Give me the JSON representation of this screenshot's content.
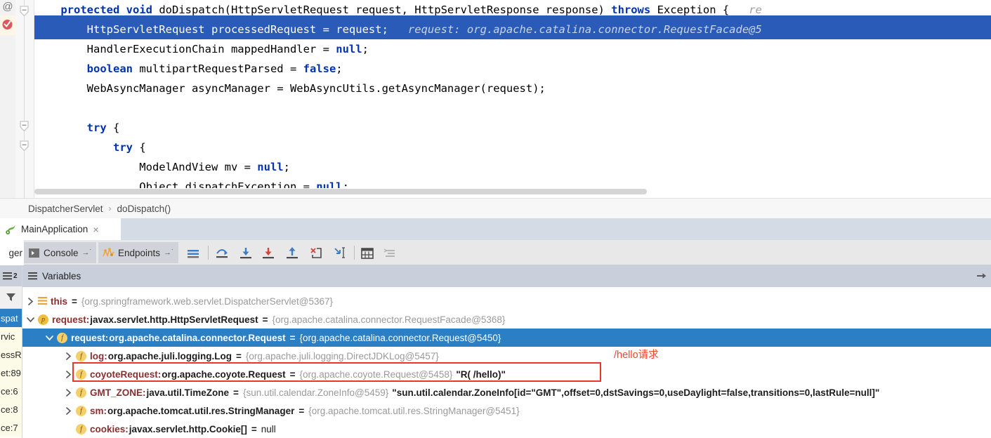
{
  "editor": {
    "gutter": {
      "annotation_icon": "@",
      "breakpoint_icon": "breakpoint-verified-icon",
      "fold_icons": [
        "fold-collapse-icon",
        "fold-collapse-icon"
      ]
    },
    "lines": [
      {
        "id": "l1",
        "highlighted": false,
        "segments": [
          {
            "text": "    ",
            "style": "plain"
          },
          {
            "text": "protected",
            "style": "kw"
          },
          {
            "text": " ",
            "style": "plain"
          },
          {
            "text": "void",
            "style": "kw"
          },
          {
            "text": " doDispatch(HttpServletRequest request, HttpServletResponse response) ",
            "style": "plain"
          },
          {
            "text": "throws",
            "style": "kw"
          },
          {
            "text": " Exception {",
            "style": "plain"
          },
          {
            "text": "   re",
            "style": "hint"
          }
        ]
      },
      {
        "id": "l2",
        "highlighted": true,
        "segments": [
          {
            "text": "        HttpServletRequest processedRequest = request;",
            "style": "plain"
          },
          {
            "text": "   request: org.apache.catalina.connector.RequestFacade@5",
            "style": "hint"
          }
        ]
      },
      {
        "id": "l3",
        "highlighted": false,
        "segments": [
          {
            "text": "        HandlerExecutionChain mappedHandler = ",
            "style": "plain"
          },
          {
            "text": "null",
            "style": "kw"
          },
          {
            "text": ";",
            "style": "plain"
          }
        ]
      },
      {
        "id": "l4",
        "highlighted": false,
        "segments": [
          {
            "text": "        ",
            "style": "plain"
          },
          {
            "text": "boolean",
            "style": "kw"
          },
          {
            "text": " multipartRequestParsed = ",
            "style": "plain"
          },
          {
            "text": "false",
            "style": "kw"
          },
          {
            "text": ";",
            "style": "plain"
          }
        ]
      },
      {
        "id": "l5",
        "highlighted": false,
        "segments": [
          {
            "text": "        WebAsyncManager asyncManager = WebAsyncUtils.getAsyncManager(request);",
            "style": "plain"
          }
        ]
      },
      {
        "id": "l6",
        "highlighted": false,
        "segments": []
      },
      {
        "id": "l7",
        "highlighted": false,
        "segments": [
          {
            "text": "        ",
            "style": "plain"
          },
          {
            "text": "try",
            "style": "kw"
          },
          {
            "text": " {",
            "style": "plain"
          }
        ]
      },
      {
        "id": "l8",
        "highlighted": false,
        "segments": [
          {
            "text": "            ",
            "style": "plain"
          },
          {
            "text": "try",
            "style": "kw"
          },
          {
            "text": " {",
            "style": "plain"
          }
        ]
      },
      {
        "id": "l9",
        "highlighted": false,
        "segments": [
          {
            "text": "                ModelAndView mv = ",
            "style": "plain"
          },
          {
            "text": "null",
            "style": "kw"
          },
          {
            "text": ";",
            "style": "plain"
          }
        ]
      },
      {
        "id": "l10",
        "highlighted": false,
        "segments": [
          {
            "text": "                Object dispatchException = ",
            "style": "plain"
          },
          {
            "text": "null",
            "style": "kw"
          },
          {
            "text": ";",
            "style": "plain"
          }
        ]
      }
    ]
  },
  "breadcrumb": {
    "class_name": "DispatcherServlet",
    "separator": "›",
    "method_name": "doDispatch()"
  },
  "run_tab": {
    "icon": "spring-leaf-icon",
    "label": "MainApplication",
    "close_label": "×"
  },
  "debug_toolbar": {
    "left_vtab_label": "ger",
    "console": {
      "label": "Console",
      "icon": "console-icon",
      "arrow": "→˙"
    },
    "endpoints": {
      "label": "Endpoints",
      "icon": "endpoints-icon",
      "arrow": "→˙"
    },
    "icon_buttons": [
      "show-execution-point-icon",
      "step-over-icon",
      "step-into-icon",
      "force-step-into-icon",
      "step-out-icon",
      "drop-frame-icon",
      "run-to-cursor-icon",
      "evaluate-expression-icon",
      "settings-lines-icon"
    ]
  },
  "frames_panel": {
    "header_icon": "frames-icon",
    "header_badge": "2",
    "filter_icon": "filter-icon",
    "rows": [
      {
        "text": "spat",
        "selected": true
      },
      {
        "text": "rvic",
        "selected": false
      },
      {
        "text": "essR",
        "selected": false
      },
      {
        "text": "et:89",
        "selected": false
      },
      {
        "text": "ce:6",
        "selected": false
      },
      {
        "text": "ce:8",
        "selected": false
      },
      {
        "text": "ce:7",
        "selected": false
      }
    ]
  },
  "variables_panel": {
    "title": "Variables",
    "header_icon": "hamburger-icon",
    "header_right_icon": "hide-panel-icon",
    "rows": [
      {
        "id": "r1",
        "indent": 0,
        "twisty": "collapsed",
        "badge_kind": "lines",
        "badge_text": "",
        "name": "this",
        "type": "",
        "eq": "=",
        "value": "{org.springframework.web.servlet.DispatcherServlet@5367}",
        "string_value": "",
        "selected": false
      },
      {
        "id": "r2",
        "indent": 0,
        "twisty": "expanded",
        "badge_kind": "p",
        "badge_text": "p",
        "name": "request:",
        "type": "javax.servlet.http.HttpServletRequest",
        "eq": "=",
        "value": "{org.apache.catalina.connector.RequestFacade@5368}",
        "string_value": "",
        "selected": false
      },
      {
        "id": "r3",
        "indent": 1,
        "twisty": "expanded",
        "badge_kind": "f",
        "badge_text": "f",
        "name": "request:",
        "type": "org.apache.catalina.connector.Request",
        "eq": "=",
        "value": "{org.apache.catalina.connector.Request@5450}",
        "string_value": "",
        "selected": true
      },
      {
        "id": "r4",
        "indent": 2,
        "twisty": "collapsed",
        "badge_kind": "f",
        "badge_text": "f",
        "name": "log:",
        "type": "org.apache.juli.logging.Log",
        "eq": "=",
        "value": "{org.apache.juli.logging.DirectJDKLog@5457}",
        "string_value": "",
        "selected": false
      },
      {
        "id": "r5",
        "indent": 2,
        "twisty": "collapsed",
        "badge_kind": "f",
        "badge_text": "f",
        "name": "coyoteRequest:",
        "type": "org.apache.coyote.Request",
        "eq": "=",
        "value": "{org.apache.coyote.Request@5458}",
        "string_value": "\"R( /hello)\"",
        "selected": false
      },
      {
        "id": "r6",
        "indent": 2,
        "twisty": "collapsed",
        "badge_kind": "f",
        "badge_text": "f",
        "name": "GMT_ZONE:",
        "type": "java.util.TimeZone",
        "eq": "=",
        "value": "{sun.util.calendar.ZoneInfo@5459}",
        "string_value": "\"sun.util.calendar.ZoneInfo[id=\"GMT\",offset=0,dstSavings=0,useDaylight=false,transitions=0,lastRule=null]\"",
        "selected": false
      },
      {
        "id": "r7",
        "indent": 2,
        "twisty": "collapsed",
        "badge_kind": "f",
        "badge_text": "f",
        "name": "sm:",
        "type": "org.apache.tomcat.util.res.StringManager",
        "eq": "=",
        "value": "{org.apache.tomcat.util.res.StringManager@5451}",
        "string_value": "",
        "selected": false
      },
      {
        "id": "r8",
        "indent": 2,
        "twisty": "none",
        "badge_kind": "f",
        "badge_text": "f",
        "name": "cookies:",
        "type": "javax.servlet.http.Cookie[]",
        "eq": "=",
        "value_plain": "null",
        "value": "",
        "string_value": "",
        "selected": false
      }
    ]
  },
  "annotations": {
    "red_box_name": "coyote-request-highlight-box",
    "red_label": "/hello请求",
    "red_color": "#e8382a",
    "label_color": "#f4442e"
  },
  "colors": {
    "selection_blue": "#2b7fc4",
    "code_selection_blue": "#2b5bb8",
    "panel_header": "#c9d0dc",
    "toolbar_bg": "#e8e8e8",
    "keyword_blue": "#0033b3",
    "var_name_red": "#8a2f2f",
    "value_gray": "#9a9a9a"
  }
}
